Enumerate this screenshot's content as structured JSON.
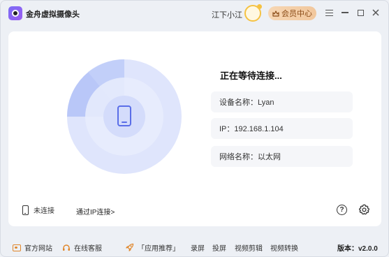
{
  "app": {
    "title": "金舟虚拟摄像头",
    "user_name": "江下小江",
    "vip_label": "会员中心"
  },
  "status": {
    "title": "正在等待连接...",
    "device_name": "设备名称：Lyan",
    "ip": "IP：192.168.1.104",
    "network_name": "网络名称：以太网"
  },
  "connection": {
    "state_label": "未连接",
    "ip_connect_link": "通过IP连接>"
  },
  "footer": {
    "official_site": "官方网站",
    "online_service": "在线客服",
    "app_recommend": "「应用推荐」",
    "screen_record": "录屏",
    "screen_cast": "投屏",
    "video_edit": "视频剪辑",
    "video_convert": "视频转换",
    "version": "版本：v2.0.0"
  },
  "colors": {
    "accent": "#5a6ee8",
    "radar_outer": "#dfe5fc",
    "radar_sweep": "#b3c2f7",
    "vip_gradient_start": "#f7d7b4",
    "footer_icon": "#e0862a"
  },
  "icons": {
    "logo": "camera-logo-icon",
    "menu": "hamburger-menu-icon",
    "minimize": "minimize-icon",
    "maximize": "maximize-icon",
    "close": "close-icon",
    "phone": "phone-icon",
    "help": "help-circle-icon",
    "settings": "gear-icon"
  }
}
